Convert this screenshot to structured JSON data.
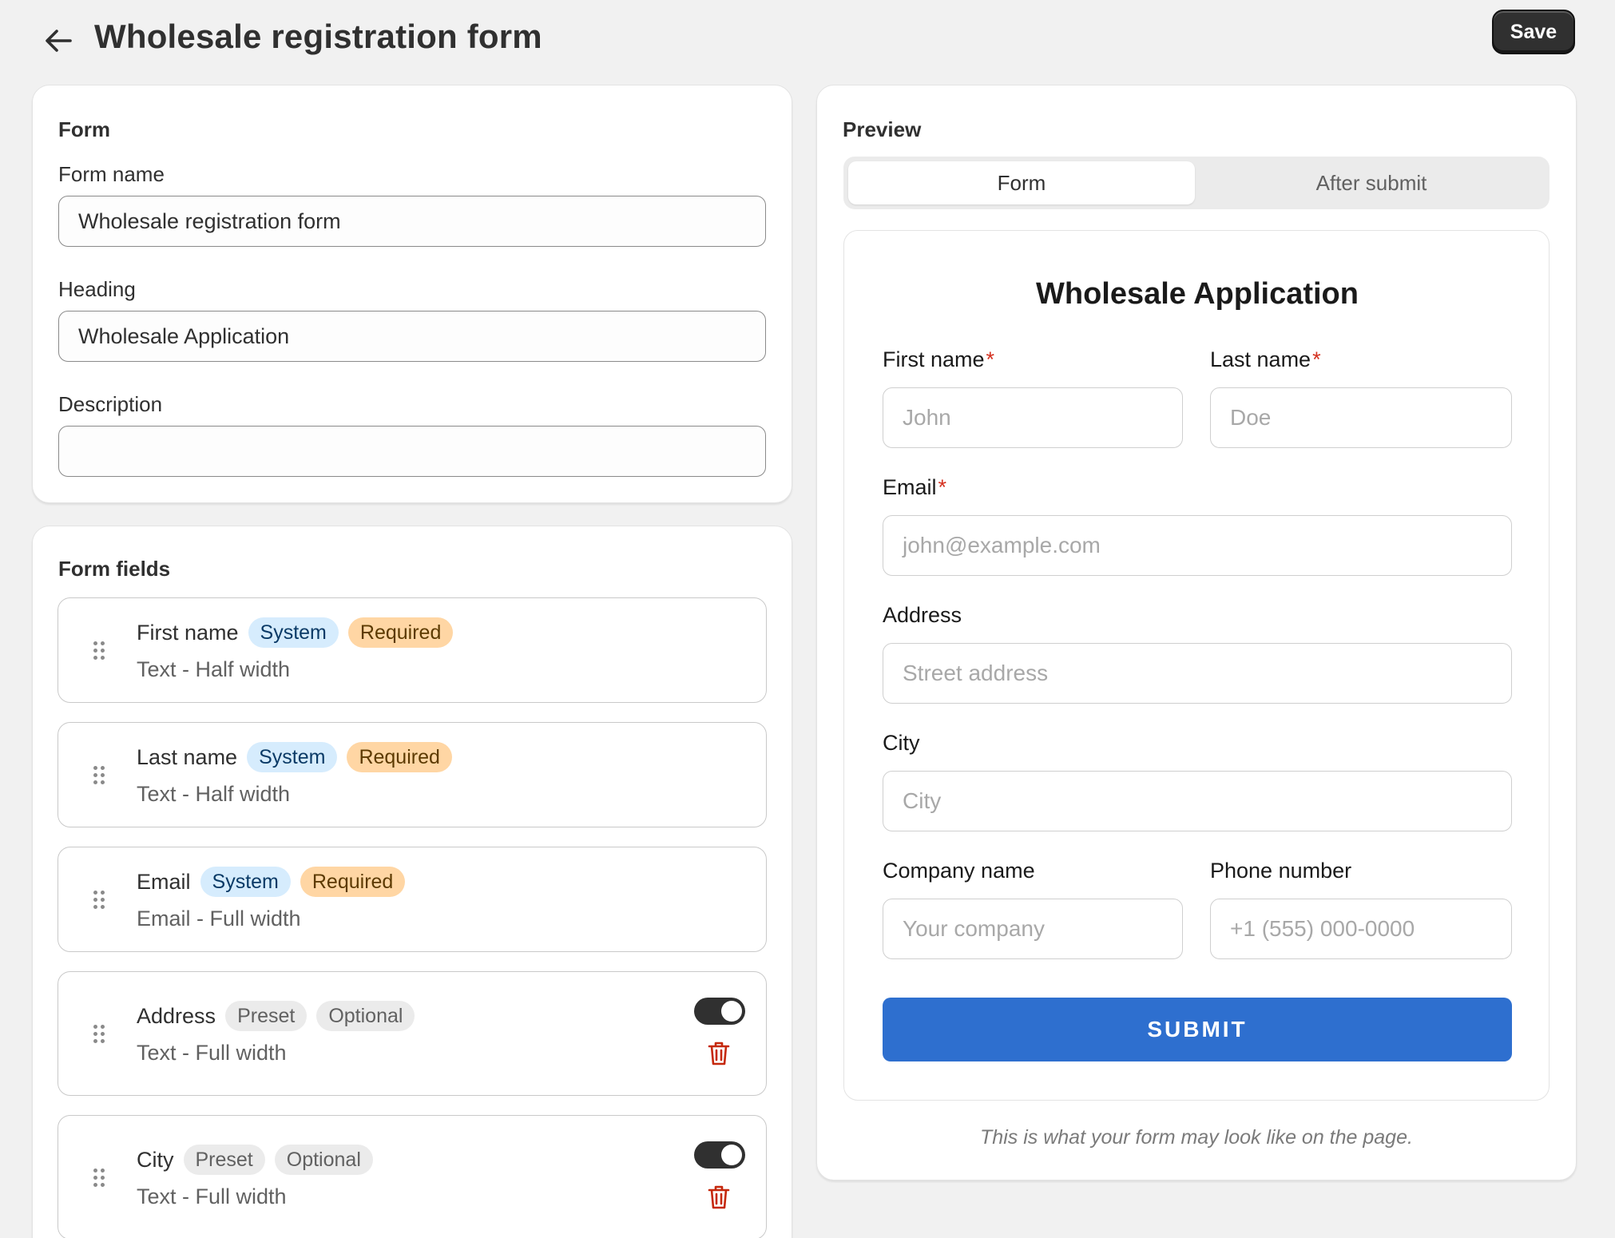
{
  "header": {
    "title": "Wholesale registration form",
    "save_label": "Save"
  },
  "form_card": {
    "title": "Form",
    "form_name_label": "Form name",
    "form_name_value": "Wholesale registration form",
    "heading_label": "Heading",
    "heading_value": "Wholesale Application",
    "description_label": "Description",
    "description_value": ""
  },
  "fields_card": {
    "title": "Form fields",
    "fields": [
      {
        "name": "First name",
        "badge1": "System",
        "badge2": "Required",
        "sub": "Text - Half width"
      },
      {
        "name": "Last name",
        "badge1": "System",
        "badge2": "Required",
        "sub": "Text - Half width"
      },
      {
        "name": "Email",
        "badge1": "System",
        "badge2": "Required",
        "sub": "Email - Full width"
      },
      {
        "name": "Address",
        "badge1": "Preset",
        "badge2": "Optional",
        "sub": "Text - Full width",
        "enabled": true
      },
      {
        "name": "City",
        "badge1": "Preset",
        "badge2": "Optional",
        "sub": "Text - Full width",
        "enabled": true
      }
    ]
  },
  "preview": {
    "title": "Preview",
    "tabs": [
      "Form",
      "After submit"
    ],
    "active_tab": "Form",
    "heading": "Wholesale Application",
    "required_mark": "*",
    "first_name_label": "First name",
    "first_name_placeholder": "John",
    "last_name_label": "Last name",
    "last_name_placeholder": "Doe",
    "email_label": "Email",
    "email_placeholder": "john@example.com",
    "address_label": "Address",
    "address_placeholder": "Street address",
    "city_label": "City",
    "city_placeholder": "City",
    "company_label": "Company name",
    "company_placeholder": "Your company",
    "phone_label": "Phone number",
    "phone_placeholder": "+1 (555) 000-0000",
    "submit_label": "SUBMIT",
    "footnote": "This is what your form may look like on the page."
  },
  "colors": {
    "page_bg": "#f1f1f1",
    "primary_dark": "#303030",
    "submit_blue": "#2e6fcf",
    "badge_system": "#d6ecfd",
    "badge_required": "#ffd6a4",
    "badge_neutral": "#ebebeb",
    "danger": "#c5280c",
    "required_star": "#d4301f"
  }
}
